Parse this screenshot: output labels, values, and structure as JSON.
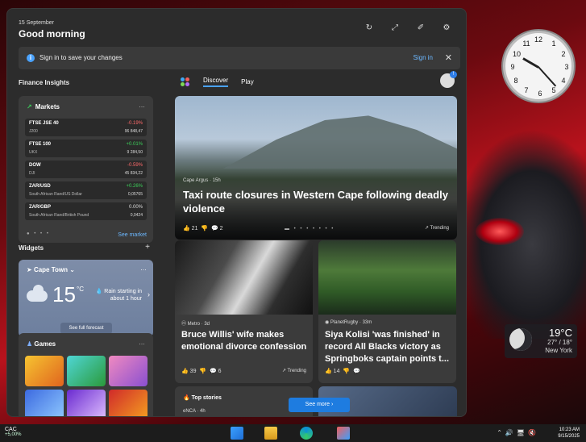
{
  "desktop": {
    "clock_numbers": [
      "12",
      "1",
      "2",
      "3",
      "4",
      "5",
      "6",
      "7",
      "8",
      "9",
      "10",
      "11"
    ],
    "weather": {
      "temp": "19°C",
      "range": "27° / 18°",
      "city": "New York"
    }
  },
  "header": {
    "date": "15 September",
    "greeting": "Good morning"
  },
  "signin_bar": {
    "message": "Sign in to save your changes",
    "link": "Sign in"
  },
  "sections": {
    "finance": "Finance Insights",
    "widgets": "Widgets"
  },
  "markets": {
    "title": "Markets",
    "rows": [
      {
        "name": "FTSE JSE 40",
        "sub": "J200",
        "change": "-0.19%",
        "value": "96 848,47",
        "dir": "neg"
      },
      {
        "name": "FTSE 100",
        "sub": "UKX",
        "change": "+0.01%",
        "value": "9 284,50",
        "dir": "pos"
      },
      {
        "name": "DOW",
        "sub": "DJI",
        "change": "-0.59%",
        "value": "45 834,22",
        "dir": "neg"
      },
      {
        "name": "ZAR/USD",
        "sub": "South African Rand/US Dollar",
        "change": "+0.26%",
        "value": "0,05765",
        "dir": "pos"
      },
      {
        "name": "ZAR/GBP",
        "sub": "South African Rand/British Pound",
        "change": "0.00%",
        "value": "0,0424",
        "dir": "neu"
      }
    ],
    "see_label": "See market"
  },
  "weather": {
    "city": "Cape Town",
    "temp": "15",
    "unit": "°C",
    "forecast": "Rain starting in about 1 hour",
    "button": "See full forecast"
  },
  "games": {
    "title": "Games"
  },
  "feed_tabs": {
    "discover": "Discover",
    "play": "Play"
  },
  "hero": {
    "source": "Cape Argus · 15h",
    "title": "Taxi route closures in Western Cape following deadly violence",
    "likes": "21",
    "comments": "2",
    "trending": "Trending"
  },
  "cards": [
    {
      "source": "Metro · 3d",
      "title": "Bruce Willis' wife makes emotional divorce confession",
      "likes": "39",
      "comments": "6",
      "trending": "Trending"
    },
    {
      "source": "PlanetRugby · 33m",
      "title": "Siya Kolisi 'was finished' in record All Blacks victory as Springboks captain points t...",
      "likes": "14",
      "comments": "",
      "trending": ""
    }
  ],
  "top_stories": {
    "title": "Top stories",
    "source": "eNCA · 4h"
  },
  "see_more": "See more",
  "taskbar": {
    "ticker": "CAC",
    "change": "+5,00%",
    "time": "10:23 AM",
    "date": "9/15/2025"
  },
  "colors": {
    "accent": "#4aa3ff",
    "positive": "#3ccf5a",
    "negative": "#ff6b6b"
  }
}
